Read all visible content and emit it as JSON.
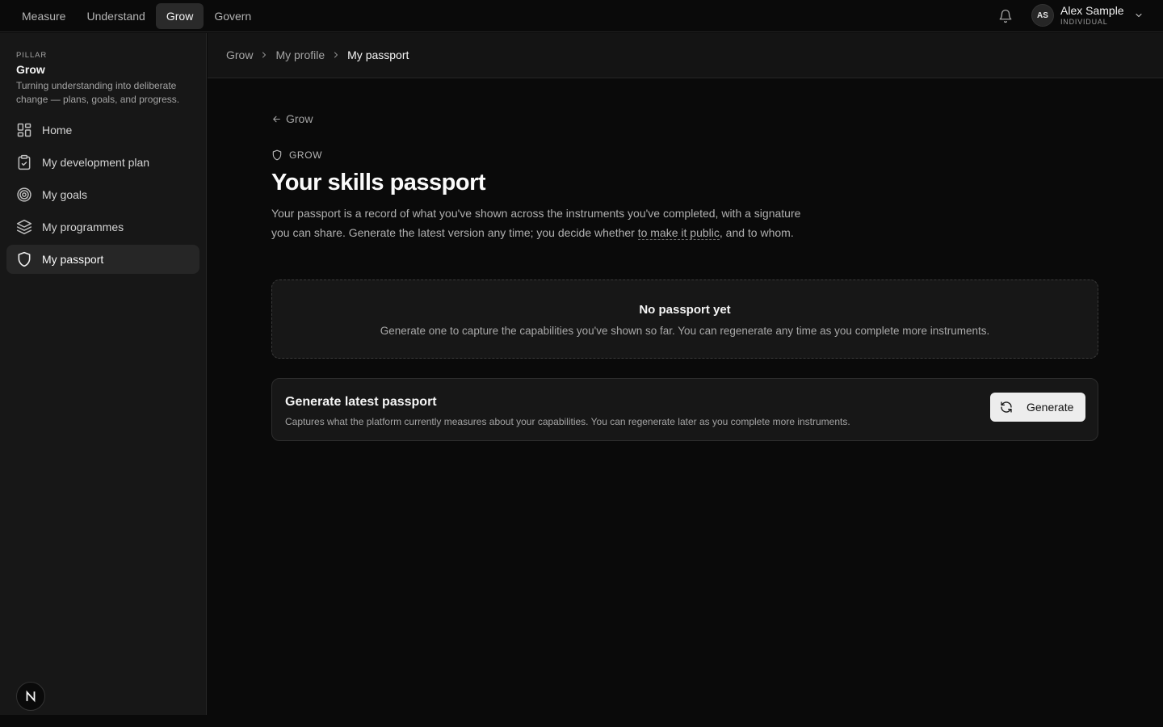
{
  "topnav": {
    "tabs": [
      {
        "label": "Measure"
      },
      {
        "label": "Understand"
      },
      {
        "label": "Grow"
      },
      {
        "label": "Govern"
      }
    ],
    "active_tab": "Grow"
  },
  "user": {
    "initials": "AS",
    "name": "Alex Sample",
    "role": "INDIVIDUAL"
  },
  "sidebar": {
    "kicker": "PILLAR",
    "title": "Grow",
    "description": "Turning understanding into deliberate change — plans, goals, and progress.",
    "items": [
      {
        "label": "Home",
        "icon": "grid-icon"
      },
      {
        "label": "My development plan",
        "icon": "clipboard-check-icon"
      },
      {
        "label": "My goals",
        "icon": "target-icon"
      },
      {
        "label": "My programmes",
        "icon": "layers-icon"
      },
      {
        "label": "My passport",
        "icon": "shield-icon"
      }
    ],
    "active_item": "My passport"
  },
  "breadcrumb": {
    "items": [
      "Grow",
      "My profile",
      "My passport"
    ]
  },
  "page": {
    "back_label": "Grow",
    "kicker": "GROW",
    "title": "Your skills passport",
    "description_before": "Your passport is a record of what you've shown across the instruments you've completed, with a signature you can share. Generate the latest version any time; you decide whether ",
    "description_link": "to make it public",
    "description_after": ", and to whom."
  },
  "empty_state": {
    "title": "No passport yet",
    "description": "Generate one to capture the capabilities you've shown so far. You can regenerate any time as you complete more instruments."
  },
  "generate_card": {
    "title": "Generate latest passport",
    "description": "Captures what the platform currently measures about your capabilities. You can regenerate later as you complete more instruments.",
    "button_label": "Generate"
  },
  "colors": {
    "background": "#0a0a0a",
    "sidebar": "#171717",
    "active": "#262626",
    "button": "#ededed"
  }
}
